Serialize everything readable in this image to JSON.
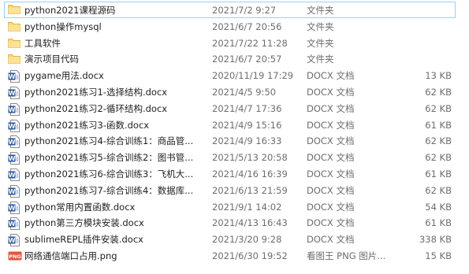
{
  "files": [
    {
      "name": "python2021课程源码",
      "date": "2021/7/2 9:27",
      "type": "文件夹",
      "size": "",
      "icon": "folder-icon",
      "selected": true
    },
    {
      "name": "python操作mysql",
      "date": "2021/6/7 20:56",
      "type": "文件夹",
      "size": "",
      "icon": "folder-icon"
    },
    {
      "name": "工具软件",
      "date": "2021/7/22 11:28",
      "type": "文件夹",
      "size": "",
      "icon": "folder-icon"
    },
    {
      "name": "演示项目代码",
      "date": "2021/6/7 20:57",
      "type": "文件夹",
      "size": "",
      "icon": "folder-icon"
    },
    {
      "name": "pygame用法.docx",
      "date": "2020/11/19 17:29",
      "type": "DOCX 文档",
      "size": "13 KB",
      "icon": "word-document-icon"
    },
    {
      "name": "python2021练习1-选择结构.docx",
      "date": "2021/4/5 9:50",
      "type": "DOCX 文档",
      "size": "62 KB",
      "icon": "word-document-icon"
    },
    {
      "name": "python2021练习2-循环结构.docx",
      "date": "2021/4/7 17:36",
      "type": "DOCX 文档",
      "size": "62 KB",
      "icon": "word-document-icon"
    },
    {
      "name": "python2021练习3-函数.docx",
      "date": "2021/4/9 15:16",
      "type": "DOCX 文档",
      "size": "61 KB",
      "icon": "word-document-icon"
    },
    {
      "name": "python2021练习4-综合训练1：商品管...",
      "date": "2021/4/9 16:33",
      "type": "DOCX 文档",
      "size": "62 KB",
      "icon": "word-document-icon"
    },
    {
      "name": "python2021练习5-综合训练2：图书管...",
      "date": "2021/5/13 20:58",
      "type": "DOCX 文档",
      "size": "62 KB",
      "icon": "word-document-icon"
    },
    {
      "name": "python2021练习6-综合训练3：飞机大...",
      "date": "2021/4/16 16:39",
      "type": "DOCX 文档",
      "size": "61 KB",
      "icon": "word-document-icon"
    },
    {
      "name": "python2021练习7-综合训练4：数据库...",
      "date": "2021/6/13 21:59",
      "type": "DOCX 文档",
      "size": "62 KB",
      "icon": "word-document-icon"
    },
    {
      "name": "python常用内置函数.docx",
      "date": "2021/9/1 14:02",
      "type": "DOCX 文档",
      "size": "54 KB",
      "icon": "word-document-icon"
    },
    {
      "name": "python第三方模块安装.docx",
      "date": "2021/4/13 16:43",
      "type": "DOCX 文档",
      "size": "61 KB",
      "icon": "word-document-icon"
    },
    {
      "name": "sublimeREPL插件安装.docx",
      "date": "2021/3/20 9:28",
      "type": "DOCX 文档",
      "size": "338 KB",
      "icon": "word-document-icon"
    },
    {
      "name": "网络通信端口占用.png",
      "date": "2021/6/30 19:52",
      "type": "看图王 PNG 图片...",
      "size": "15 KB",
      "icon": "png-image-icon"
    }
  ],
  "colors": {
    "folder": "#f8d775",
    "folder_dark": "#e3b642",
    "word": "#2b579a",
    "png": "#e8543c",
    "selection_border": "#99d1ff"
  }
}
